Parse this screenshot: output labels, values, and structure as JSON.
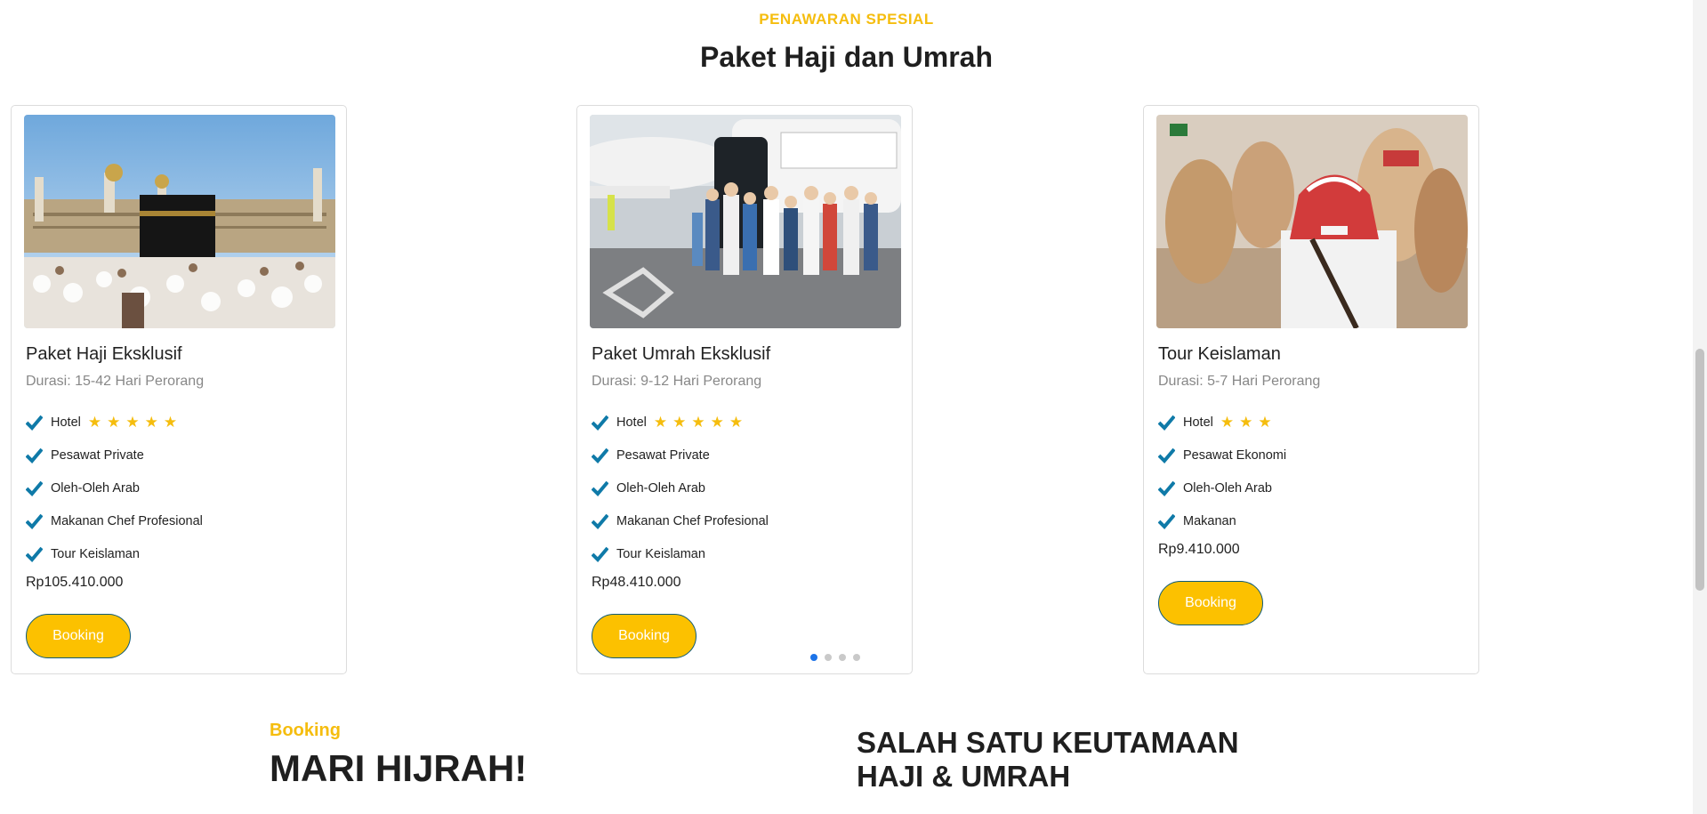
{
  "section": {
    "eyebrow": "PENAWARAN SPESIAL",
    "title": "Paket Haji dan Umrah"
  },
  "packages": [
    {
      "name": "Paket Haji Eksklusif",
      "duration": "Durasi: 15-42 Hari Perorang",
      "image_icon": "kaaba-photo",
      "hotel_label": "Hotel",
      "hotel_stars": 5,
      "features": [
        "Pesawat Private",
        "Oleh-Oleh Arab",
        "Makanan Chef Profesional",
        "Tour Keislaman"
      ],
      "price": "Rp105.410.000",
      "button": "Booking"
    },
    {
      "name": "Paket Umrah Eksklusif",
      "duration": "Durasi: 9-12 Hari Perorang",
      "image_icon": "airport-pilgrims-photo",
      "hotel_label": "Hotel",
      "hotel_stars": 5,
      "features": [
        "Pesawat Private",
        "Oleh-Oleh Arab",
        "Makanan Chef Profesional",
        "Tour Keislaman"
      ],
      "price": "Rp48.410.000",
      "button": "Booking"
    },
    {
      "name": "Tour Keislaman",
      "duration": "Durasi: 5-7 Hari Perorang",
      "image_icon": "camel-man-photo",
      "hotel_label": "Hotel",
      "hotel_stars": 3,
      "features": [
        "Pesawat Ekonomi",
        "Oleh-Oleh Arab",
        "Makanan"
      ],
      "price": "Rp9.410.000",
      "button": "Booking"
    }
  ],
  "carousel": {
    "total": 4,
    "active_index": 0
  },
  "booking_section": {
    "eyebrow": "Booking",
    "title": "MARI HIJRAH!",
    "virtue_line1": "SALAH SATU KEUTAMAAN",
    "virtue_line2": "HAJI & UMRAH"
  },
  "colors": {
    "accent": "#f5bd0e",
    "button_bg": "#fcc100",
    "check": "#0f7aa8",
    "dot_active": "#1c73e8"
  }
}
